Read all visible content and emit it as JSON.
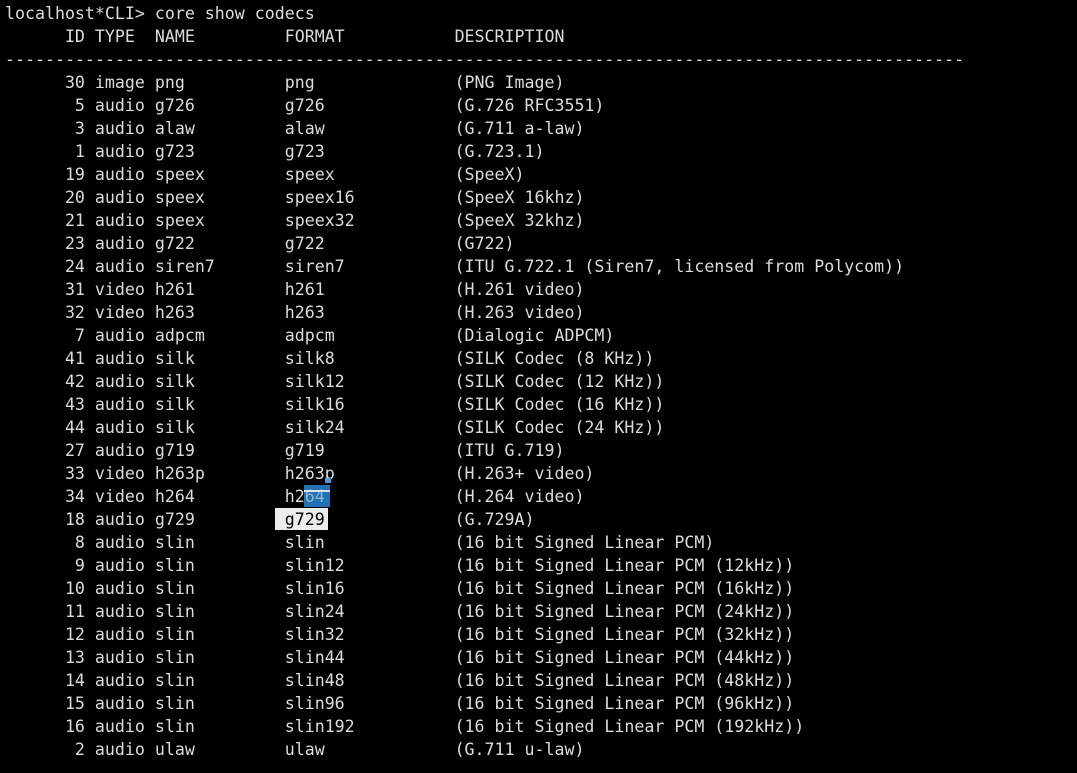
{
  "terminal": {
    "prompt": "localhost*CLI> ",
    "command": "core show codecs",
    "separator": "------------------------------------------------------------------------------------------------",
    "colors": {
      "background": "#000000",
      "foreground": "#dcdcdc",
      "selection_background": "#2171b4",
      "selection_text": "#8fb3d1",
      "selection_overline": "#d9e3ec",
      "selection_notch": "#4f9bd3",
      "match_background": "#ececec",
      "match_text": "#000000"
    }
  },
  "table": {
    "columns": [
      "ID",
      "TYPE",
      "NAME",
      "FORMAT",
      "DESCRIPTION"
    ],
    "rows": [
      {
        "id": 30,
        "type": "image",
        "name": "png",
        "format": "png",
        "description": "(PNG Image)"
      },
      {
        "id": 5,
        "type": "audio",
        "name": "g726",
        "format": "g726",
        "description": "(G.726 RFC3551)"
      },
      {
        "id": 3,
        "type": "audio",
        "name": "alaw",
        "format": "alaw",
        "description": "(G.711 a-law)"
      },
      {
        "id": 1,
        "type": "audio",
        "name": "g723",
        "format": "g723",
        "description": "(G.723.1)"
      },
      {
        "id": 19,
        "type": "audio",
        "name": "speex",
        "format": "speex",
        "description": "(SpeeX)"
      },
      {
        "id": 20,
        "type": "audio",
        "name": "speex",
        "format": "speex16",
        "description": "(SpeeX 16khz)"
      },
      {
        "id": 21,
        "type": "audio",
        "name": "speex",
        "format": "speex32",
        "description": "(SpeeX 32khz)"
      },
      {
        "id": 23,
        "type": "audio",
        "name": "g722",
        "format": "g722",
        "description": "(G722)"
      },
      {
        "id": 24,
        "type": "audio",
        "name": "siren7",
        "format": "siren7",
        "description": "(ITU G.722.1 (Siren7, licensed from Polycom))"
      },
      {
        "id": 31,
        "type": "video",
        "name": "h261",
        "format": "h261",
        "description": "(H.261 video)"
      },
      {
        "id": 32,
        "type": "video",
        "name": "h263",
        "format": "h263",
        "description": "(H.263 video)"
      },
      {
        "id": 7,
        "type": "audio",
        "name": "adpcm",
        "format": "adpcm",
        "description": "(Dialogic ADPCM)"
      },
      {
        "id": 41,
        "type": "audio",
        "name": "silk",
        "format": "silk8",
        "description": "(SILK Codec (8 KHz))"
      },
      {
        "id": 42,
        "type": "audio",
        "name": "silk",
        "format": "silk12",
        "description": "(SILK Codec (12 KHz))"
      },
      {
        "id": 43,
        "type": "audio",
        "name": "silk",
        "format": "silk16",
        "description": "(SILK Codec (16 KHz))"
      },
      {
        "id": 44,
        "type": "audio",
        "name": "silk",
        "format": "silk24",
        "description": "(SILK Codec (24 KHz))"
      },
      {
        "id": 27,
        "type": "audio",
        "name": "g719",
        "format": "g719",
        "description": "(ITU G.719)"
      },
      {
        "id": 33,
        "type": "video",
        "name": "h263p",
        "format": "h263p",
        "description": "(H.263+ video)"
      },
      {
        "id": 34,
        "type": "video",
        "name": "h264",
        "format": "h264",
        "description": "(H.264 video)",
        "highlight": {
          "kind": "selection",
          "prefix": "h2",
          "selected": "64"
        }
      },
      {
        "id": 18,
        "type": "audio",
        "name": "g729",
        "format": "g729",
        "description": "(G.729A)",
        "highlight": {
          "kind": "match",
          "text": "g729"
        }
      },
      {
        "id": 8,
        "type": "audio",
        "name": "slin",
        "format": "slin",
        "description": "(16 bit Signed Linear PCM)"
      },
      {
        "id": 9,
        "type": "audio",
        "name": "slin",
        "format": "slin12",
        "description": "(16 bit Signed Linear PCM (12kHz))"
      },
      {
        "id": 10,
        "type": "audio",
        "name": "slin",
        "format": "slin16",
        "description": "(16 bit Signed Linear PCM (16kHz))"
      },
      {
        "id": 11,
        "type": "audio",
        "name": "slin",
        "format": "slin24",
        "description": "(16 bit Signed Linear PCM (24kHz))"
      },
      {
        "id": 12,
        "type": "audio",
        "name": "slin",
        "format": "slin32",
        "description": "(16 bit Signed Linear PCM (32kHz))"
      },
      {
        "id": 13,
        "type": "audio",
        "name": "slin",
        "format": "slin44",
        "description": "(16 bit Signed Linear PCM (44kHz))"
      },
      {
        "id": 14,
        "type": "audio",
        "name": "slin",
        "format": "slin48",
        "description": "(16 bit Signed Linear PCM (48kHz))"
      },
      {
        "id": 15,
        "type": "audio",
        "name": "slin",
        "format": "slin96",
        "description": "(16 bit Signed Linear PCM (96kHz))"
      },
      {
        "id": 16,
        "type": "audio",
        "name": "slin",
        "format": "slin192",
        "description": "(16 bit Signed Linear PCM (192kHz))"
      },
      {
        "id": 2,
        "type": "audio",
        "name": "ulaw",
        "format": "ulaw",
        "description": "(G.711 u-law)"
      }
    ]
  }
}
